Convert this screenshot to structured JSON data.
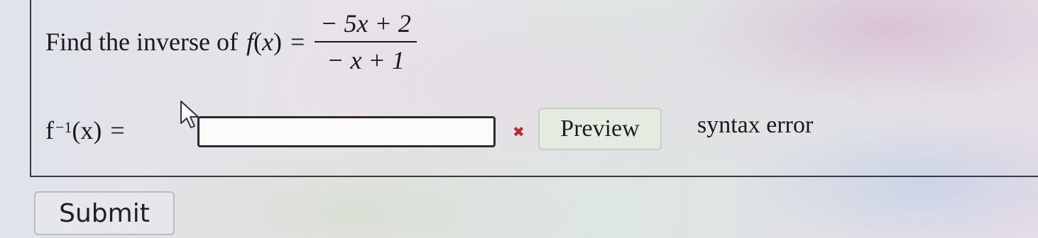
{
  "question": {
    "prompt": "Find the inverse of",
    "function_lhs": "f",
    "variable": "x",
    "equals": "=",
    "numerator": "− 5x + 2",
    "denominator": "− x + 1"
  },
  "answer": {
    "lhs_func": "f",
    "lhs_sup": "−1",
    "lhs_var": "x",
    "equals": "=",
    "input_value": "",
    "status_icon": "error-x-icon",
    "preview_label": "Preview",
    "status_text": "syntax error"
  },
  "submit_label": "Submit",
  "colors": {
    "error": "#c0282e",
    "preview_bg": "#e4ece2"
  }
}
